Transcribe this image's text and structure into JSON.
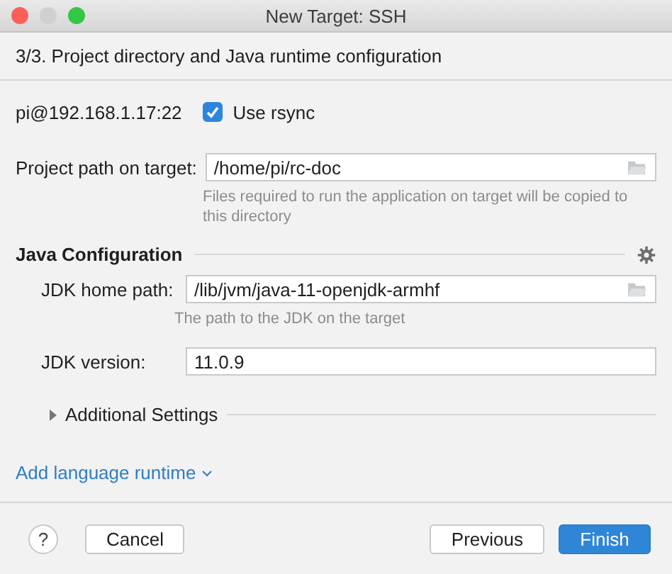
{
  "window": {
    "title": "New Target: SSH"
  },
  "step": "3/3. Project directory and Java runtime configuration",
  "connection": {
    "host": "pi@192.168.1.17:22",
    "rsync": {
      "label": "Use rsync",
      "checked": true
    }
  },
  "project_path": {
    "label": "Project path on target:",
    "value": "/home/pi/rc-doc",
    "hint": "Files required to run the application on target will be copied to this directory"
  },
  "java": {
    "title": "Java Configuration",
    "jdk_home": {
      "label": "JDK home path:",
      "value": "/lib/jvm/java-11-openjdk-armhf",
      "hint": "The path to the JDK on the target"
    },
    "jdk_version": {
      "label": "JDK version:",
      "value": "11.0.9"
    },
    "additional": {
      "label": "Additional Settings",
      "expanded": false
    }
  },
  "add_runtime": "Add language runtime",
  "buttons": {
    "help": "?",
    "cancel": "Cancel",
    "previous": "Previous",
    "finish": "Finish"
  }
}
